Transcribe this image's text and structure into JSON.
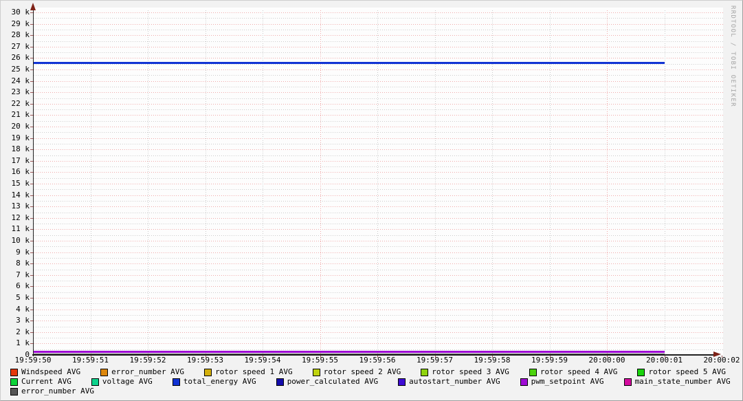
{
  "watermark": "RRDTOOL / TOBI OETIKER",
  "colors": {
    "background": "#f2f2f2",
    "canvas": "#fdfdfd",
    "major_grid": "#f0a8a8",
    "minor_grid": "#cbcbcb",
    "axis": "#222222",
    "arrow": "#7e2217",
    "tick": "#a05a5a",
    "text": "#000000",
    "watermark_text": "#a5a5a5"
  },
  "chart_data": {
    "type": "line",
    "title": "",
    "xlabel": "",
    "ylabel": "",
    "x_axis": {
      "tick_labels": [
        "19:59:50",
        "19:59:51",
        "19:59:52",
        "19:59:53",
        "19:59:54",
        "19:59:55",
        "19:59:56",
        "19:59:57",
        "19:59:58",
        "19:59:59",
        "20:00:00",
        "20:00:01",
        "20:00:02"
      ],
      "major_gridlines": [
        "19:59:55",
        "20:00:00"
      ],
      "minor_gridline_step_seconds": 1
    },
    "y_axis": {
      "min": 0,
      "max": 30000,
      "major_step": 1000,
      "minor_step": 500,
      "tick_labels": [
        "30 k",
        "29 k",
        "28 k",
        "27 k",
        "26 k",
        "25 k",
        "24 k",
        "23 k",
        "22 k",
        "21 k",
        "20 k",
        "19 k",
        "18 k",
        "17 k",
        "16 k",
        "15 k",
        "14 k",
        "13 k",
        "12 k",
        "11 k",
        "10 k",
        "9 k",
        "8 k",
        "7 k",
        "6 k",
        "5 k",
        "4 k",
        "3 k",
        "2 k",
        "1 k",
        "0"
      ]
    },
    "series": [
      {
        "name": "Windspeed AVG",
        "color": "#e5380b",
        "value": 0,
        "visible": false,
        "x_start": "19:59:50",
        "x_end": "20:00:01"
      },
      {
        "name": "error_number AVG",
        "color": "#dd870c",
        "value": 0,
        "visible": false,
        "x_start": "19:59:50",
        "x_end": "20:00:01"
      },
      {
        "name": "rotor speed 1 AVG",
        "color": "#d4b00c",
        "value": 0,
        "visible": false,
        "x_start": "19:59:50",
        "x_end": "20:00:01"
      },
      {
        "name": "rotor speed 2 AVG",
        "color": "#bfd30d",
        "value": 0,
        "visible": false,
        "x_start": "19:59:50",
        "x_end": "20:00:01"
      },
      {
        "name": "rotor speed 3 AVG",
        "color": "#8fd30d",
        "value": 0,
        "visible": false,
        "x_start": "19:59:50",
        "x_end": "20:00:01"
      },
      {
        "name": "rotor speed 4 AVG",
        "color": "#4cd30d",
        "value": 0,
        "visible": false,
        "x_start": "19:59:50",
        "x_end": "20:00:01"
      },
      {
        "name": "rotor speed 5 AVG",
        "color": "#1bd30d",
        "value": 0,
        "visible": false,
        "x_start": "19:59:50",
        "x_end": "20:00:01"
      },
      {
        "name": "Current AVG",
        "color": "#0dd338",
        "value": 0,
        "visible": false,
        "x_start": "19:59:50",
        "x_end": "20:00:01"
      },
      {
        "name": "voltage AVG",
        "color": "#0dd38c",
        "value": 0,
        "visible": false,
        "x_start": "19:59:50",
        "x_end": "20:00:01"
      },
      {
        "name": "total_energy AVG",
        "color": "#1133d4",
        "value": 25550,
        "visible": true,
        "x_start": "19:59:50",
        "x_end": "20:00:01"
      },
      {
        "name": "power_calculated AVG",
        "color": "#130cab",
        "value": 0,
        "visible": false,
        "x_start": "19:59:50",
        "x_end": "20:00:01"
      },
      {
        "name": "autostart_number AVG",
        "color": "#3e0cd4",
        "value": 0,
        "visible": false,
        "x_start": "19:59:50",
        "x_end": "20:00:01"
      },
      {
        "name": "pwm_setpoint AVG",
        "color": "#9e0cd4",
        "value": 270,
        "visible": true,
        "x_start": "19:59:50",
        "x_end": "20:00:01"
      },
      {
        "name": "main_state_number AVG",
        "color": "#d40c9e",
        "value": 0,
        "visible": false,
        "x_start": "19:59:50",
        "x_end": "20:00:01"
      },
      {
        "name": "error_number AVG",
        "color": "#555555",
        "value": 0,
        "visible": true,
        "x_start": "19:59:50",
        "x_end": "20:00:01"
      }
    ],
    "legend": {
      "position": "bottom",
      "rows": [
        7,
        7,
        1
      ]
    },
    "grid": true
  }
}
